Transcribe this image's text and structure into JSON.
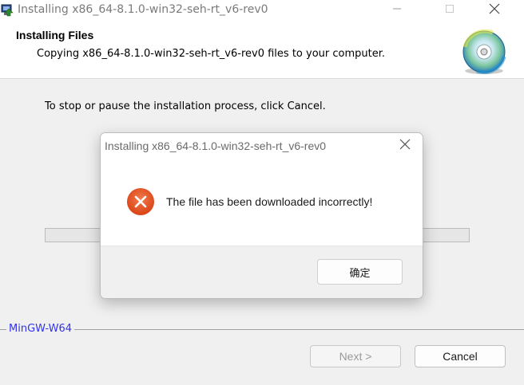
{
  "window": {
    "title": "Installing x86_64-8.1.0-win32-seh-rt_v6-rev0",
    "minimize_icon": "minimize-icon",
    "maximize_icon": "maximize-icon",
    "close_icon": "close-icon"
  },
  "header": {
    "title": "Installing Files",
    "subtitle": "Copying x86_64-8.1.0-win32-seh-rt_v6-rev0 files to your computer.",
    "icon": "cd-disc-icon"
  },
  "body": {
    "instruction": "To stop or pause the installation process, click Cancel.",
    "progress": 0
  },
  "footer": {
    "brand": "MinGW-W64",
    "next_label": "Next >",
    "cancel_label": "Cancel"
  },
  "dialog": {
    "title": "Installing x86_64-8.1.0-win32-seh-rt_v6-rev0",
    "message": "The file has been downloaded incorrectly!",
    "ok_label": "确定",
    "icon": "error-icon"
  },
  "colors": {
    "error_red": "#e5532b",
    "brand_blue": "#3333ee"
  }
}
